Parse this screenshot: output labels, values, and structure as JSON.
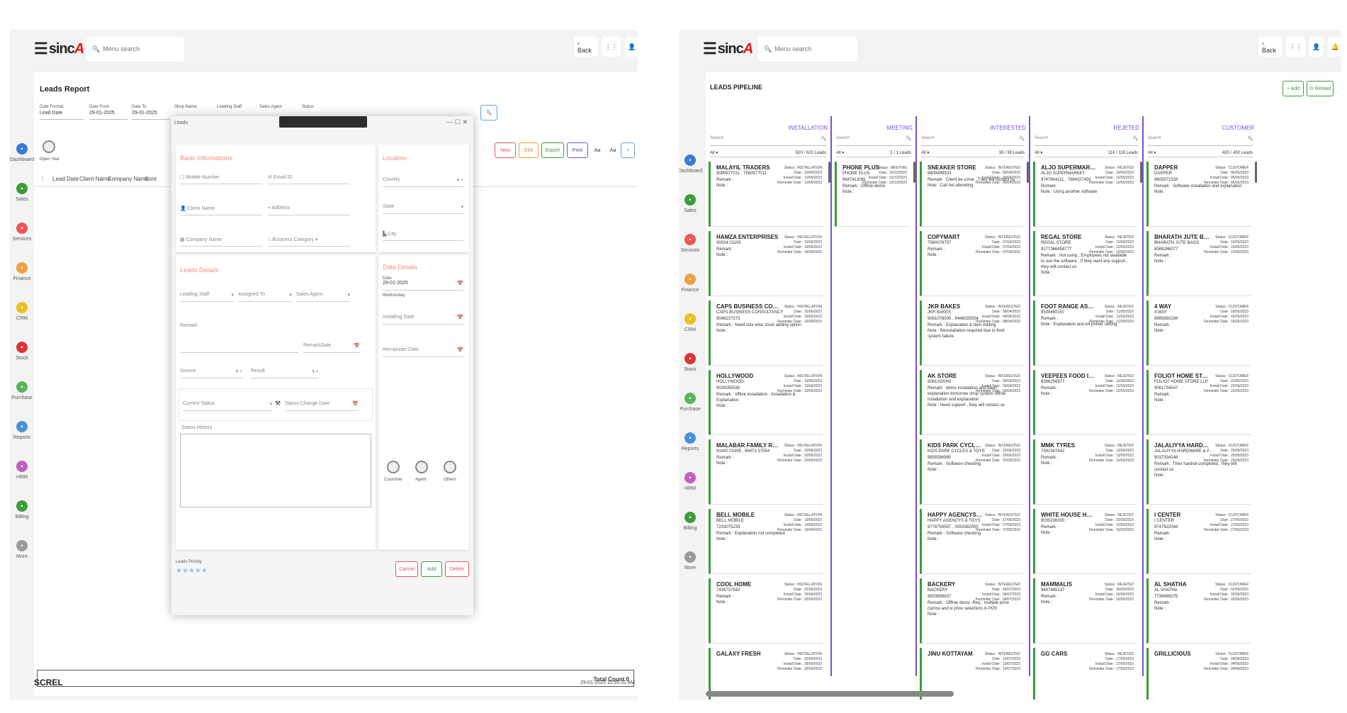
{
  "left": {
    "logo_text": "sinc",
    "logo_a": "A",
    "search_placeholder": "Menu search",
    "back_label": "‹ Back",
    "page_title": "Leads Report",
    "filters": [
      {
        "label": "Date Format",
        "value": "Lead Date"
      },
      {
        "label": "Date From",
        "value": "29-01-2025"
      },
      {
        "label": "Date To",
        "value": "29-01-2025"
      },
      {
        "label": "Shop Name",
        "value": ""
      },
      {
        "label": "Leading Staff",
        "value": ""
      },
      {
        "label": "Sales Agent",
        "value": ""
      },
      {
        "label": "Status",
        "value": ""
      }
    ],
    "toggle_label": "Open Year",
    "actions": {
      "new": "New",
      "edit": "Edit",
      "export": "Export",
      "print": "Print",
      "a1": "Aa",
      "a2": "Aa",
      "plus": "+"
    },
    "columns": [
      "Lead Date",
      "Client Name",
      "Company Name",
      "Cont"
    ],
    "total_label": "Total Count",
    "total_value": "0",
    "footer_brand": "SCREL",
    "footer_time": "29-01-2025 10:55:31 AM",
    "sidebar": [
      "Dashboard",
      "Sales",
      "Services",
      "Finance",
      "CRM",
      "Stock",
      "Purchase",
      "Reports",
      "HRM",
      "Billing",
      "More"
    ],
    "modal": {
      "title": "Leads",
      "basic_title": "Basic Informations",
      "mobile": "Mobile Number",
      "email": "Email ID",
      "client": "Client Name",
      "address": "Address",
      "company": "Company Name",
      "category": "Business Category",
      "location_title": "Location",
      "country": "Country",
      "state": "State",
      "city": "City",
      "lead_title": "Leads Details",
      "leading_staff": "Leading Staff",
      "assigned": "Assigned To",
      "sales_agent": "Sales Agent",
      "remark": "Remark",
      "remark_date": "RemarkDate",
      "source": "Source",
      "result": "Result",
      "current_status": "Current Status",
      "status_change": "Status Change Date",
      "status_history": "Status History",
      "date_title": "Date Details",
      "date_label": "Date",
      "date_value": "29-01-2025",
      "weekday": "Wednesday",
      "installing": "Installing Date",
      "reminder": "Remainder Date",
      "opt_customer": "Customer",
      "opt_agent": "Agent",
      "opt_others": "Others",
      "priority": "Leads Priority",
      "cancel": "Cancel",
      "add": "Add",
      "delete": "Delete"
    }
  },
  "right": {
    "logo_text": "sinc",
    "logo_a": "A",
    "search_placeholder": "Menu search",
    "back_label": "‹ Back",
    "page_title": "LEADS PIPELINE",
    "add_label": "+ Add",
    "reload_label": "⟳ Reload",
    "sidebar": [
      "Dashboard",
      "Sales",
      "Services",
      "Finance",
      "CRM",
      "Stock",
      "Purchase",
      "Reports",
      "HRM",
      "Billing",
      "More"
    ],
    "search_label": "Search",
    "filter_all": "All",
    "columns": [
      {
        "title": "INSTALLATION",
        "count": "620 / 620 Leads",
        "status": "INSTALLATION",
        "cards": [
          {
            "name": "MALAYIL TRADERS",
            "line1": "",
            "line2": "8089977011 , 7560977011",
            "remark": "Remark :",
            "note": "Note :",
            "date": "10/06/2023"
          },
          {
            "name": "HAMZA ENTERPRISES",
            "line1": "",
            "line2": "90024 01193",
            "remark": "Remark :",
            "note": "Note :",
            "date": "19/06/2023"
          },
          {
            "name": "CAPS BUSINESS CONSULTANCY",
            "line1": "CAPS BUSINESS CONSULTANCY",
            "line2": "9048237373",
            "remark": "Remark : Need size wise stock adding option",
            "note": "Note :",
            "date": "15/06/2023"
          },
          {
            "name": "HOLLYWOOD",
            "line1": "HOLLYWOOD",
            "line2": "9020055530",
            "remark": "Remark : offline installation - Installation & Explanation",
            "note": "Note :",
            "date": "19/06/2023"
          },
          {
            "name": "MALABAR FAMILY RESTAURANT",
            "line1": "",
            "line2": "91400 01995 , 99473 37554",
            "remark": "Remark :",
            "note": "Note :",
            "date": "20/06/2023"
          },
          {
            "name": "BELL MOBILE",
            "line1": "BELL MOBILE",
            "line2": "7203075233",
            "remark": "Remark : Explanation not completed",
            "note": "Note :",
            "date": "19/06/2023"
          },
          {
            "name": "COOL HOME",
            "line1": "",
            "line2": "7435737942",
            "remark": "Remark :",
            "note": "Note :",
            "date": "25/06/2023"
          },
          {
            "name": "GALAXY FRESH",
            "line1": "",
            "line2": "",
            "remark": "",
            "note": "",
            "date": "26/06/2023"
          }
        ]
      },
      {
        "title": "MEETING",
        "count": "1 / 1 Leads",
        "status": "MEETING",
        "cards": [
          {
            "name": "PHONE PLUS",
            "line1": "PHONE PLUS",
            "line2": "9847413081",
            "remark": "Remark : Offline demo",
            "note": "Note :",
            "date": "10/12/2023"
          }
        ]
      },
      {
        "title": "INTERESTED",
        "count": "38 / 38 Leads",
        "status": "INTERESTED",
        "cards": [
          {
            "name": "SNEAKER STORE",
            "line1": "",
            "line2": "9809999933",
            "remark": "Remark : Client be come , They will contact us",
            "note": "Note : Call not attending",
            "date": "06/04/2023"
          },
          {
            "name": "COPYMART",
            "line1": "",
            "line2": "7560076757",
            "remark": "Remark :",
            "note": "Note :",
            "date": "07/04/2023"
          },
          {
            "name": "JKR BAKES",
            "line1": "JKR BAKES",
            "line2": "9061078000 , 9446035504",
            "remark": "Remark : Explanation & Item Adding",
            "note": "Note : Reinstallation required due to their system failure",
            "date": "08/04/2023"
          },
          {
            "name": "AK STORE",
            "line1": "",
            "line2": "9061020000",
            "remark": "Remark : demo installation and basic explanation tomorrow shop system offline installation and explanation",
            "note": "Note : Need support , they will contact us",
            "date": "09/04/2023"
          },
          {
            "name": "KIDS PARK CYCLES & TOYS",
            "line1": "KIDS PARK CYCLES & TOYS",
            "line2": "9655596990",
            "remark": "Remark : Software checking",
            "note": "Note :",
            "date": "20/06/2023"
          },
          {
            "name": "HAPPY AGENCYS & TOYS",
            "line1": "HAPPY AGENCYS & TOYS",
            "line2": "9778783557 , 0033082000",
            "remark": "Remark : Software checking",
            "note": "Note :",
            "date": "27/06/2023"
          },
          {
            "name": "BACKERY",
            "line1": "BACKERY",
            "line2": "9633958637",
            "remark": "Remark : Offline demo -Req : multiple price (sprice and w price selection) in POS",
            "note": "Note :",
            "date": "04/07/2023"
          },
          {
            "name": "JINU KOTTAYAM",
            "line1": "",
            "line2": "",
            "remark": "",
            "note": "",
            "date": "10/07/2023"
          }
        ]
      },
      {
        "title": "REJETED",
        "count": "116 / 116 Leads",
        "status": "REJETED",
        "cards": [
          {
            "name": "ALJO SUPERMARKET",
            "line1": "ALJO SUPERMARKET",
            "line2": "9747844111 , 7994327430",
            "remark": "Remark :",
            "note": "Note : Using another software",
            "date": "10/05/2023"
          },
          {
            "name": "REGAL STORE",
            "line1": "REGAL STORE",
            "line2": "9177366458777",
            "remark": "Remark : Not using , Employees not available to use the software , If they want any support , they will contact us",
            "note": "Note :",
            "date": "10/05/2023"
          },
          {
            "name": "FOOT RANGE ASSOCIATES (OTTAVA)",
            "line1": "",
            "line2": "9539460157",
            "remark": "Remark :",
            "note": "Note : Explanation and A4 printer setting",
            "date": "11/05/2023"
          },
          {
            "name": "VEEPEES FOOD INGREDIETS",
            "line1": "",
            "line2": "8086256977",
            "remark": "Remark :",
            "note": "Note :",
            "date": "12/05/2023"
          },
          {
            "name": "MMK TYRES",
            "line1": "",
            "line2": "7592347442",
            "remark": "Remark :",
            "note": "Note :",
            "date": "13/05/2023"
          },
          {
            "name": "WHITE HOUSE HOLIDAYS",
            "line1": "",
            "line2": "8035206330",
            "remark": "Remark :",
            "note": "Note :",
            "date": "15/05/2023"
          },
          {
            "name": "MAMMALIS",
            "line1": "",
            "line2": "9847465137",
            "remark": "Remark :",
            "note": "Note :",
            "date": "16/05/2023"
          },
          {
            "name": "GG CARS",
            "line1": "",
            "line2": "",
            "remark": "",
            "note": "",
            "date": "17/05/2023"
          }
        ]
      },
      {
        "title": "CUSTOMER",
        "count": "430 / 430 Leads",
        "status": "CUSTOMER",
        "cards": [
          {
            "name": "DAPPER",
            "line1": "DAPPER",
            "line2": "9605571533",
            "remark": "Remark : Software installation and explanation",
            "note": "Note :",
            "date": "06/05/2023"
          },
          {
            "name": "BHARATH JUTE BAGS",
            "line1": "BHARATH JUTE BAGS",
            "line2": "8089286077",
            "remark": "Remark :",
            "note": "Note :",
            "date": "10/05/2023"
          },
          {
            "name": "4 WAY",
            "line1": "4 WAY",
            "line2": "9995993194",
            "remark": "Remark :",
            "note": "Note :",
            "date": "16/05/2023"
          },
          {
            "name": "FOLIOT HOME STORE LLP",
            "line1": "FOLIOT HOME STORE LLP",
            "line2": "9061734547",
            "remark": "Remark :",
            "note": "Note :",
            "date": "22/05/2023"
          },
          {
            "name": "JALALIYYA HARDWARE & FURNITURES",
            "line1": "JALALIYYA HARDWARE & FURNITURE STORES",
            "line2": "9037334248",
            "remark": "Remark : Their hardisk completed , they will contact us",
            "note": "Note :",
            "date": "25/05/2023"
          },
          {
            "name": "I CENTER",
            "line1": "I CENTER",
            "line2": "9747922044",
            "remark": "Remark :",
            "note": "Note :",
            "date": "27/05/2023"
          },
          {
            "name": "AL SHATHA",
            "line1": "AL SHATHA",
            "line2": "7736665075",
            "remark": "Remark :",
            "note": "Note :",
            "date": "02/06/2023"
          },
          {
            "name": "GRILLICIOUS",
            "line1": "",
            "line2": "",
            "remark": "",
            "note": "",
            "date": "04/06/2023"
          }
        ]
      }
    ]
  },
  "colors": {
    "accent": "#7a4ddb",
    "card_border": "#3b9c3b",
    "section": "#f38e82"
  }
}
